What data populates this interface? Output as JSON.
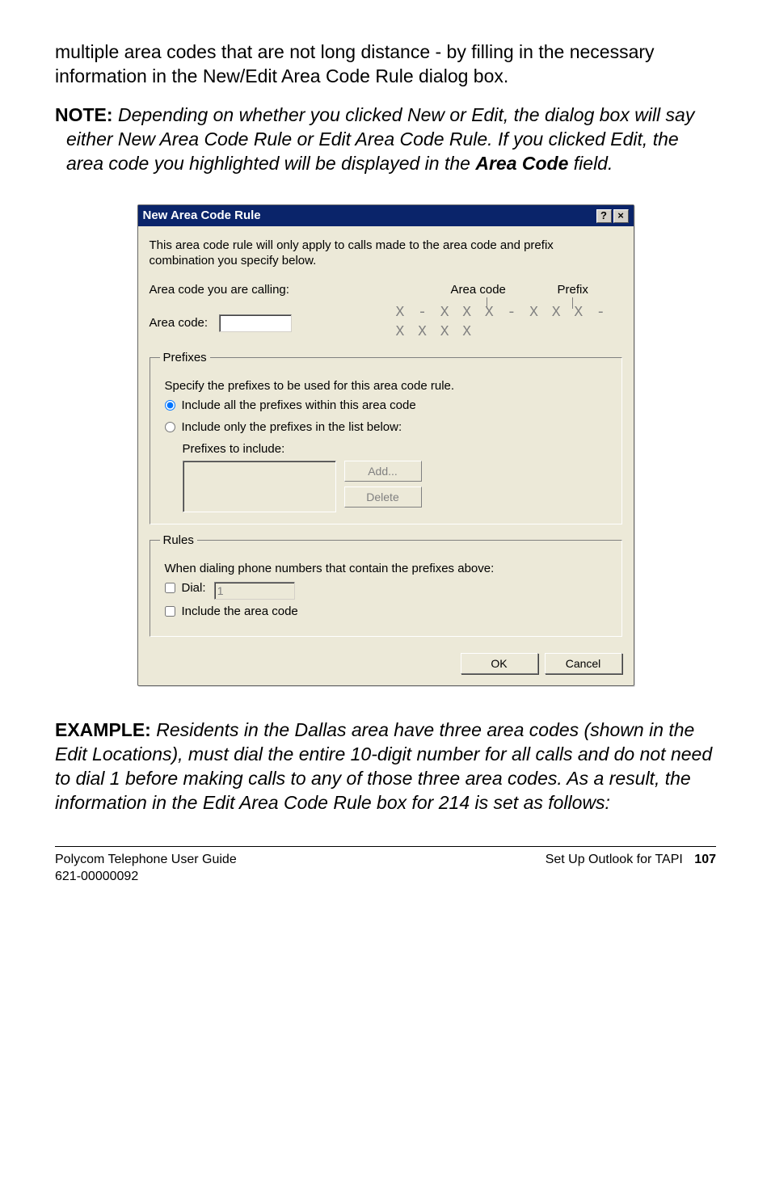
{
  "intro": "multiple area codes that are not long distance - by filling in the necessary information in the New/Edit Area Code Rule dialog box.",
  "note": {
    "label": "NOTE:",
    "text": "Depending on whether you clicked New or Edit, the dialog box will say either New Area Code Rule or Edit Area Code Rule. If you clicked Edit, the area code you highlighted will be displayed in the ",
    "field_ref": "Area Code",
    "text2": " field."
  },
  "dialog": {
    "title": "New Area Code Rule",
    "help": "?",
    "close": "×",
    "desc": "This area code rule will only apply to calls made to the area code and prefix combination you specify below.",
    "calling_label": "Area code you are calling:",
    "col_area": "Area code",
    "col_prefix": "Prefix",
    "ac_label": "Area code:",
    "ac_value": "",
    "format": "X - X X X - X X X - X X X X",
    "prefixes": {
      "legend": "Prefixes",
      "desc": "Specify the prefixes to be used for this area code rule.",
      "opt_all": "Include all the prefixes within this area code",
      "opt_below": "Include only the prefixes in the list below:",
      "include_label": "Prefixes to include:",
      "add": "Add...",
      "delete": "Delete"
    },
    "rules": {
      "legend": "Rules",
      "desc": "When dialing phone numbers that contain the prefixes above:",
      "dial_label": "Dial:",
      "dial_value": "1",
      "include_ac": "Include the area code"
    },
    "ok": "OK",
    "cancel": "Cancel"
  },
  "example": {
    "label": "EXAMPLE: ",
    "text": "Residents in the Dallas area have three area codes (shown in the Edit Locations), must dial the entire 10-digit number for all calls and do not need to dial 1 before making calls to any of those three area codes. As a result, the information in the Edit Area Code Rule box for 214 is set as follows:"
  },
  "footer": {
    "left1": "Polycom Telephone User Guide",
    "left2": "621-00000092",
    "right": "Set Up Outlook for TAPI",
    "page": "107"
  }
}
